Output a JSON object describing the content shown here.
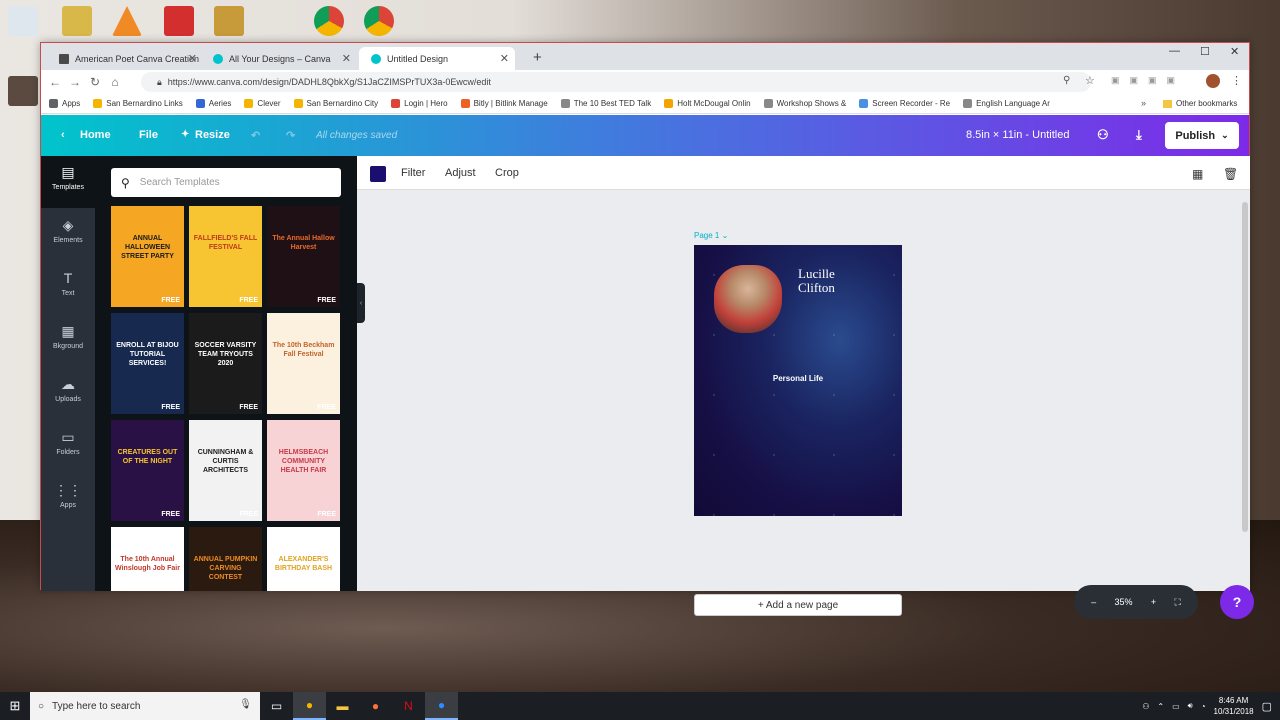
{
  "tabs": [
    {
      "label": "American Poet Canva Creation"
    },
    {
      "label": "All Your Designs – Canva"
    },
    {
      "label": "Untitled Design"
    }
  ],
  "address_bar": {
    "url": "https://www.canva.com/design/DADHL8QbkXg/S1JaCZIMSPrTUX3a-0Ewcw/edit"
  },
  "bookmarks": [
    {
      "label": "Apps",
      "color": "#5f6368"
    },
    {
      "label": "San Bernardino Links",
      "color": "#f4b400"
    },
    {
      "label": "Aeries",
      "color": "#3367d6"
    },
    {
      "label": "Clever",
      "color": "#f4b400"
    },
    {
      "label": "San Bernardino City",
      "color": "#f4b400"
    },
    {
      "label": "Login | Hero",
      "color": "#db4437"
    },
    {
      "label": "Bitly | Bitlink Manage",
      "color": "#ee6123"
    },
    {
      "label": "The 10 Best TED Talk",
      "color": "#888888"
    },
    {
      "label": "Holt McDougal Onlin",
      "color": "#f4a400"
    },
    {
      "label": "Workshop Shows &",
      "color": "#888888"
    },
    {
      "label": "Screen Recorder - Re",
      "color": "#4a90e2"
    },
    {
      "label": "English Language Ar",
      "color": "#888888"
    }
  ],
  "other_bookmarks": "Other bookmarks",
  "canva_header": {
    "home": "Home",
    "file": "File",
    "resize": "Resize",
    "saved_status": "All changes saved",
    "doc_title": "8.5in × 11in - Untitled",
    "publish": "Publish"
  },
  "sidenav": [
    {
      "label": "Templates",
      "icon": "▤"
    },
    {
      "label": "Elements",
      "icon": "◈"
    },
    {
      "label": "Text",
      "icon": "T"
    },
    {
      "label": "Bkground",
      "icon": "▦"
    },
    {
      "label": "Uploads",
      "icon": "☁"
    },
    {
      "label": "Folders",
      "icon": "▭"
    },
    {
      "label": "Apps",
      "icon": "⋮⋮"
    }
  ],
  "search": {
    "placeholder": "Search Templates"
  },
  "templates": [
    {
      "title": "ANNUAL HALLOWEEN STREET PARTY",
      "bg": "#f5a623",
      "fg": "#1a1a1a",
      "badge": "FREE"
    },
    {
      "title": "FALLFIELD'S FALL FESTIVAL",
      "bg": "#f7c531",
      "fg": "#c0391b",
      "badge": "FREE"
    },
    {
      "title": "The Annual Hallow Harvest",
      "bg": "#1f1016",
      "fg": "#e86a2a",
      "badge": "FREE"
    },
    {
      "title": "ENROLL AT BIJOU TUTORIAL SERVICES!",
      "bg": "#17294f",
      "fg": "#ffffff",
      "badge": "FREE"
    },
    {
      "title": "SOCCER VARSITY TEAM TRYOUTS 2020",
      "bg": "#1b1b1b",
      "fg": "#ffffff",
      "badge": "FREE"
    },
    {
      "title": "The 10th Beckham Fall Festival",
      "bg": "#fbf1de",
      "fg": "#c2632c",
      "badge": "FREE"
    },
    {
      "title": "CREATURES OUT OF THE NIGHT",
      "bg": "#2a1145",
      "fg": "#f7c531",
      "badge": "FREE"
    },
    {
      "title": "CUNNINGHAM & CURTIS ARCHITECTS",
      "bg": "#f2f2f2",
      "fg": "#1b1b1b",
      "badge": "FREE"
    },
    {
      "title": "HELMSBEACH COMMUNITY HEALTH FAIR",
      "bg": "#f7d3d6",
      "fg": "#c83a4a",
      "badge": "FREE"
    },
    {
      "title": "The 10th Annual Winslough Job Fair",
      "bg": "#ffffff",
      "fg": "#c0392b",
      "badge": ""
    },
    {
      "title": "ANNUAL PUMPKIN CARVING CONTEST",
      "bg": "#2a1a10",
      "fg": "#f08a24",
      "badge": ""
    },
    {
      "title": "ALEXANDER'S BIRTHDAY BASH",
      "bg": "#ffffff",
      "fg": "#e0a321",
      "badge": ""
    }
  ],
  "toolbar": {
    "filter": "Filter",
    "adjust": "Adjust",
    "crop": "Crop",
    "swatch_color": "#1a0e6e"
  },
  "page": {
    "label": "Page 1",
    "name_line1": "Lucille",
    "name_line2": "Clifton",
    "title": "Personal Life"
  },
  "add_page": "+ Add a new page",
  "zoom": {
    "minus": "–",
    "value": "35%",
    "plus": "+"
  },
  "help": "?",
  "taskbar": {
    "search_placeholder": "Type here to search",
    "time": "8:46 AM",
    "date": "10/31/2018"
  }
}
